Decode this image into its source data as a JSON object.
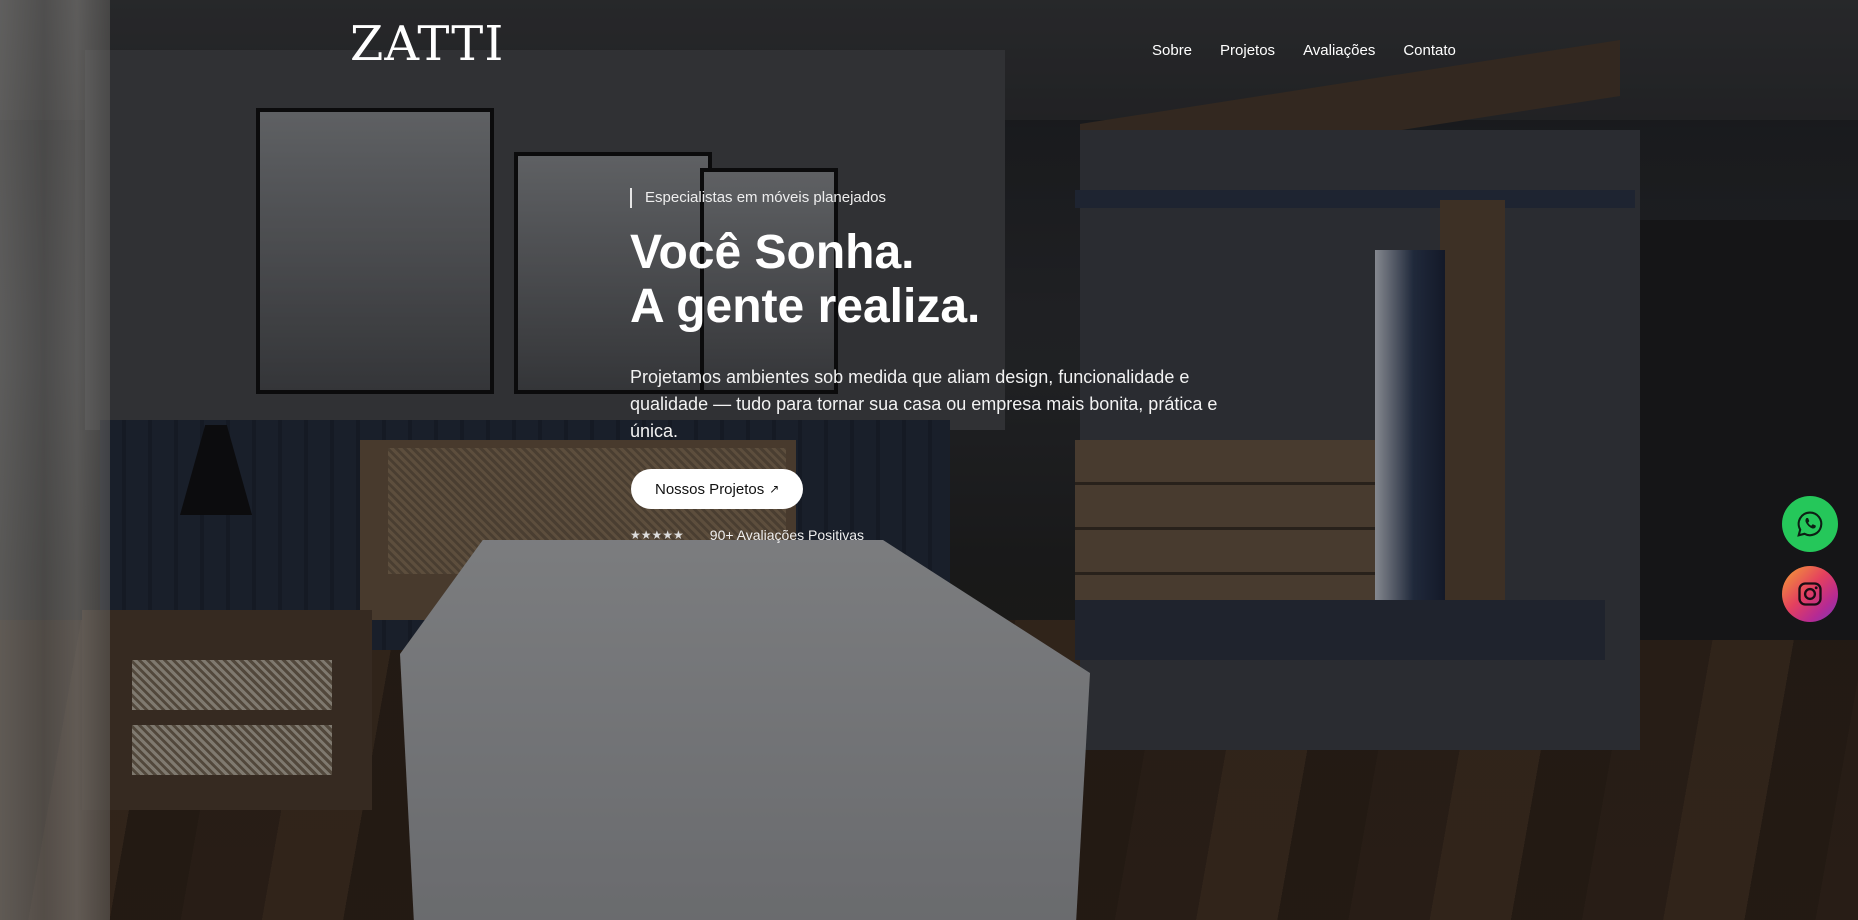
{
  "brand": {
    "logo": "ZATTI"
  },
  "nav": {
    "items": [
      {
        "label": "Sobre"
      },
      {
        "label": "Projetos"
      },
      {
        "label": "Avaliações"
      },
      {
        "label": "Contato"
      }
    ]
  },
  "hero": {
    "eyebrow": "Especialistas em móveis planejados",
    "headline_line1": "Você Sonha.",
    "headline_line2": "A gente realiza.",
    "lead": "Projetamos ambientes sob medida que aliam design, funcionalidade e qualidade — tudo para tornar sua casa ou empresa mais bonita, prática e única.",
    "cta_label": "Nossos Projetos",
    "cta_arrow": "↗",
    "stars": "★★★★★",
    "rating_text": "90+ Avaliações Positivas",
    "background_image": "bedroom-with-walk-in-closet"
  },
  "floating": {
    "whatsapp_icon": "whatsapp-icon",
    "whatsapp_color": "#25c75a",
    "instagram_icon": "instagram-icon"
  }
}
